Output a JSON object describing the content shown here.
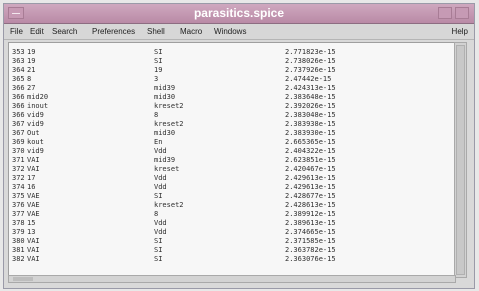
{
  "window": {
    "title": "parasitics.spice"
  },
  "menu": {
    "items": [
      "File",
      "Edit",
      "Search",
      "Preferences",
      "Shell",
      "Macro",
      "Windows"
    ],
    "help": "Help"
  },
  "lines": [
    [
      "353",
      "19",
      "SI",
      "2.771823e-15"
    ],
    [
      "363",
      "19",
      "SI",
      "2.738026e-15"
    ],
    [
      "364",
      "21",
      "19",
      "2.737926e-15"
    ],
    [
      "365",
      "8",
      "3",
      "2.47442e-15"
    ],
    [
      "366",
      "27",
      "mid39",
      "2.424313e-15"
    ],
    [
      "366",
      "mid20",
      "mid30",
      "2.383648e-15"
    ],
    [
      "366",
      "inout",
      "kreset2",
      "2.392026e-15"
    ],
    [
      "366",
      "vid9",
      "8",
      "2.383048e-15"
    ],
    [
      "367",
      "vid9",
      "kreset2",
      "2.383938e-15"
    ],
    [
      "367",
      "Out",
      "mid30",
      "2.383930e-15"
    ],
    [
      "369",
      "kout",
      "En",
      "2.665365e-15"
    ],
    [
      "370",
      "vid9",
      "Vdd",
      "2.404322e-15"
    ],
    [
      "371",
      "VAI",
      "mid39",
      "2.623851e-15"
    ],
    [
      "372",
      "VAI",
      "kreset",
      "2.420467e-15"
    ],
    [
      "372",
      "17",
      "Vdd",
      "2.429613e-15"
    ],
    [
      "374",
      "16",
      "Vdd",
      "2.429613e-15"
    ],
    [
      "375",
      "VAE",
      "SI",
      "2.428677e-15"
    ],
    [
      "376",
      "VAE",
      "kreset2",
      "2.428613e-15"
    ],
    [
      "377",
      "VAE",
      "8",
      "2.389912e-15"
    ],
    [
      "378",
      "15",
      "Vdd",
      "2.389613e-15"
    ],
    [
      "379",
      "13",
      "Vdd",
      "2.374665e-15"
    ],
    [
      "380",
      "VAI",
      "SI",
      "2.371585e-15"
    ],
    [
      "381",
      "VAI",
      "SI",
      "2.363782e-15"
    ],
    [
      "382",
      "VAI",
      "SI",
      "2.363076e-15"
    ]
  ]
}
